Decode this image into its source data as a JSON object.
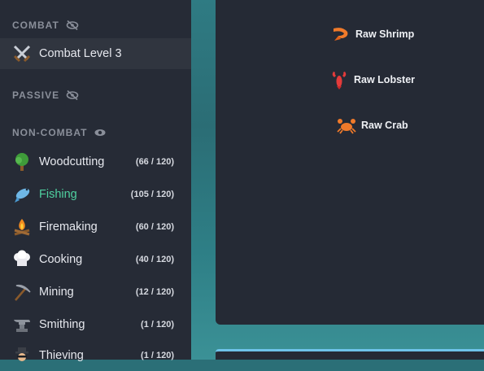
{
  "sidebar": {
    "combat_header": "COMBAT",
    "combat_item": "Combat Level 3",
    "passive_header": "PASSIVE",
    "noncombat_header": "NON-COMBAT",
    "skills": [
      {
        "label": "Woodcutting",
        "count": "(66 / 120)",
        "icon": "tree-icon"
      },
      {
        "label": "Fishing",
        "count": "(105 / 120)",
        "icon": "fish-icon"
      },
      {
        "label": "Firemaking",
        "count": "(60 / 120)",
        "icon": "campfire-icon"
      },
      {
        "label": "Cooking",
        "count": "(40 / 120)",
        "icon": "chef-hat-icon"
      },
      {
        "label": "Mining",
        "count": "(12 / 120)",
        "icon": "pickaxe-icon"
      },
      {
        "label": "Smithing",
        "count": "(1 / 120)",
        "icon": "anvil-icon"
      },
      {
        "label": "Thieving",
        "count": "(1 / 120)",
        "icon": "thief-icon"
      }
    ]
  },
  "panel": {
    "items": [
      {
        "label": "Raw Shrimp",
        "icon": "shrimp-icon"
      },
      {
        "label": "Raw Lobster",
        "icon": "lobster-icon"
      },
      {
        "label": "Raw Crab",
        "icon": "crab-icon"
      }
    ]
  },
  "colors": {
    "sidebar_bg": "#262b36",
    "active_row_bg": "#30353f",
    "selected_text": "#4fd1a0",
    "panel_bg": "#252a35",
    "accent_strip": "#6ec3ea"
  }
}
